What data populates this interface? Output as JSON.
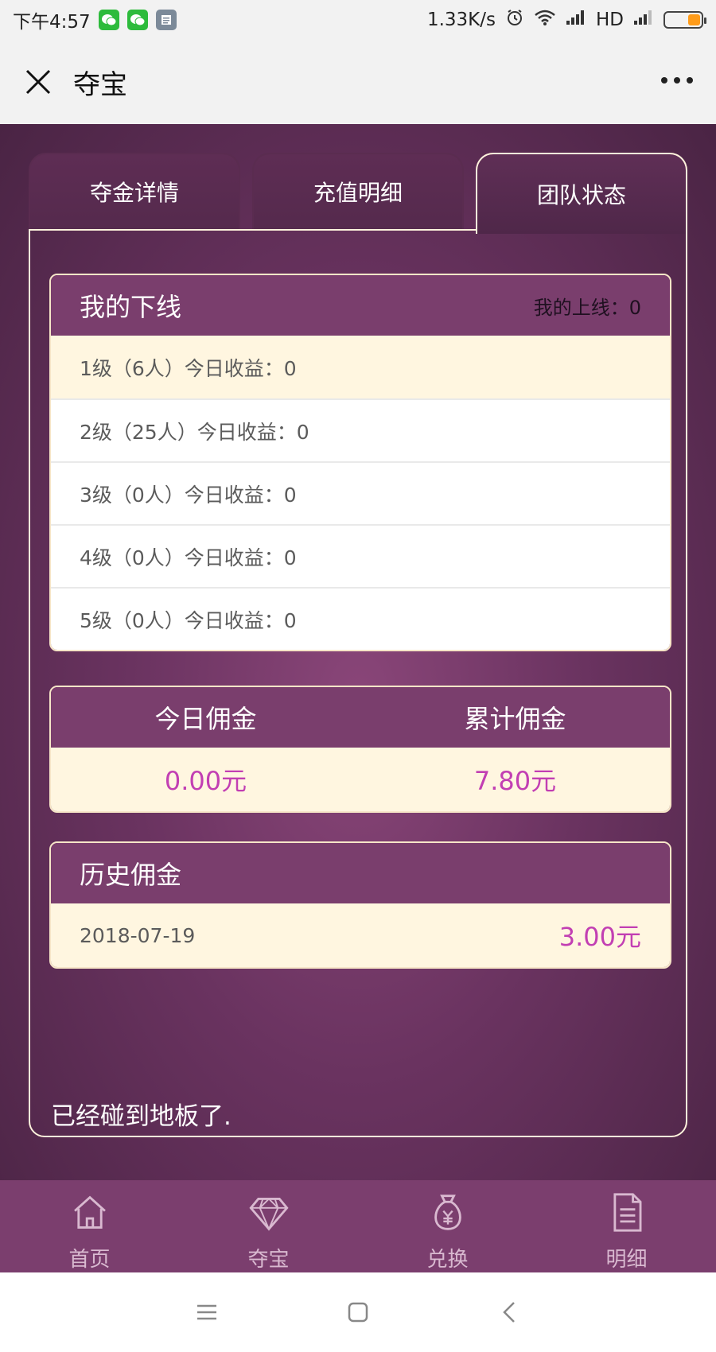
{
  "status_bar": {
    "time": "下午4:57",
    "network_speed": "1.33K/s",
    "network_type": "HD",
    "battery_level": 0.35
  },
  "title_bar": {
    "title": "夺宝"
  },
  "tabs": [
    {
      "label": "夺金详情",
      "active": false
    },
    {
      "label": "充值明细",
      "active": false
    },
    {
      "label": "团队状态",
      "active": true
    }
  ],
  "downline": {
    "title": "我的下线",
    "upline_label": "我的上线：0",
    "rows": [
      "1级（6人）今日收益：0",
      "2级（25人）今日收益：0",
      "3级（0人）今日收益：0",
      "4级（0人）今日收益：0",
      "5级（0人）今日收益：0"
    ]
  },
  "commission": {
    "today_label": "今日佣金",
    "total_label": "累计佣金",
    "today_value": "0.00元",
    "total_value": "7.80元"
  },
  "history": {
    "title": "历史佣金",
    "entries": [
      {
        "date": "2018-07-19",
        "amount": "3.00元"
      }
    ]
  },
  "end_note": "已经碰到地板了.",
  "bottom_nav": [
    {
      "label": "首页",
      "icon": "home-icon"
    },
    {
      "label": "夺宝",
      "icon": "diamond-icon"
    },
    {
      "label": "兑换",
      "icon": "money-bag-icon"
    },
    {
      "label": "明细",
      "icon": "document-icon"
    }
  ],
  "colors": {
    "header_purple": "#7a3e6d",
    "cream": "#fff6e0",
    "accent_magenta": "#c23fb3"
  }
}
